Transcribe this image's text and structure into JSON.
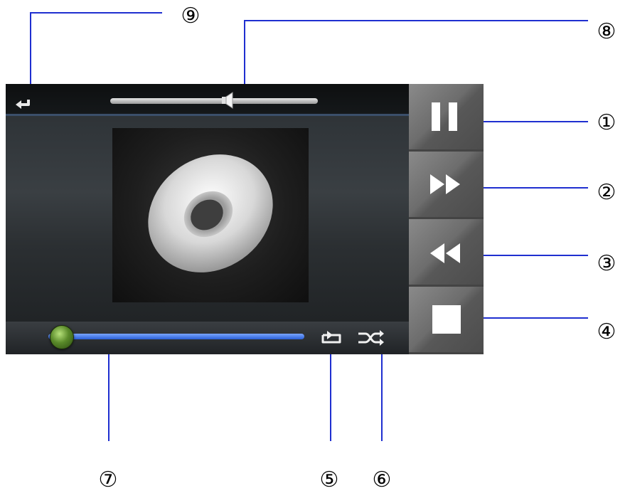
{
  "callouts": {
    "pause": "①",
    "next": "②",
    "previous": "③",
    "stop": "④",
    "repeat": "⑤",
    "shuffle": "⑥",
    "progress": "⑦",
    "volume": "⑧",
    "back": "⑨"
  },
  "player": {
    "volume_level": 0.57,
    "progress_level": 0.05
  },
  "icons": {
    "back": "return-arrow-icon",
    "volume": "speaker-icon",
    "album": "disc-icon",
    "repeat": "repeat-icon",
    "shuffle": "shuffle-icon",
    "pause": "pause-icon",
    "next": "fast-forward-icon",
    "previous": "rewind-icon",
    "stop": "stop-icon"
  },
  "colors": {
    "callout_line": "#1f2fd0",
    "progress_bar": "#2a5fd6",
    "progress_thumb": "#5a8a2a"
  }
}
